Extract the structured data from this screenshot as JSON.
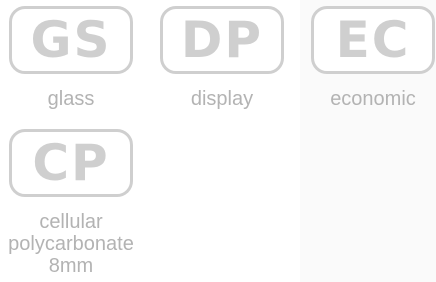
{
  "options": [
    {
      "code": "GS",
      "label_lines": [
        "glass"
      ]
    },
    {
      "code": "DP",
      "label_lines": [
        "display"
      ]
    },
    {
      "code": "EC",
      "label_lines": [
        "economic"
      ]
    },
    {
      "code": "CP",
      "label_lines": [
        "cellular",
        "polycarbonate",
        "8mm"
      ]
    }
  ],
  "colors": {
    "badge_border": "#cfcfcf",
    "badge_text": "#cfcfcf",
    "label_text": "#b3b3b3"
  }
}
